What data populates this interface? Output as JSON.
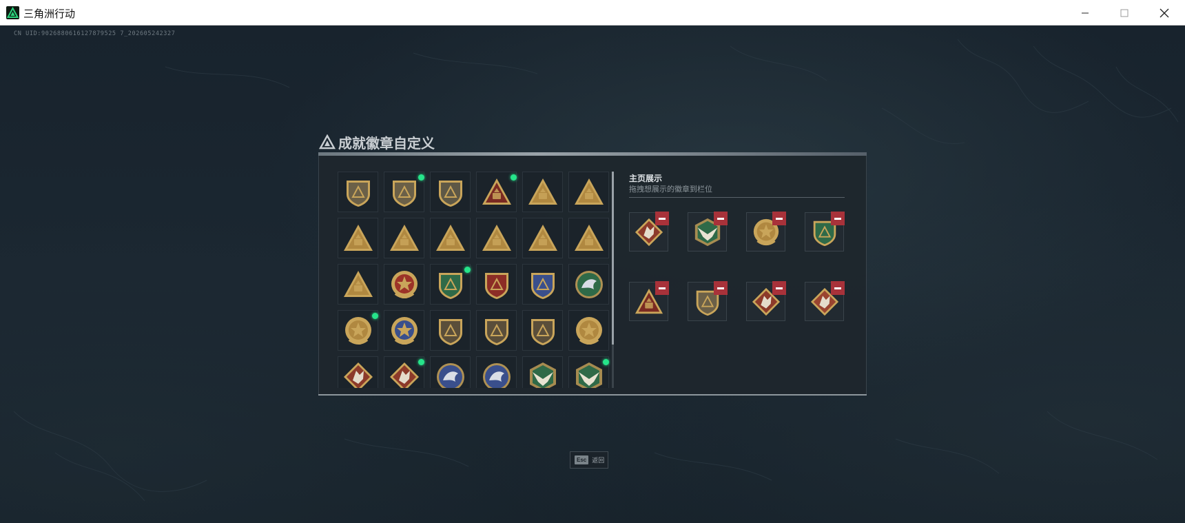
{
  "window": {
    "title": "三角洲行动",
    "app_icon": "delta-force-logo-icon",
    "controls": [
      "minimize-icon",
      "maximize-icon",
      "close-icon"
    ]
  },
  "uid_text": "CN UID:9026880616127879525 7_202605242327",
  "dialog": {
    "title": "成就徽章自定义",
    "title_icon": "delta-triangle-icon"
  },
  "badges": [
    {
      "name": "shield-triangle-badge",
      "shape": "shield",
      "color": "#6b6048",
      "new": false
    },
    {
      "name": "helicopter-badge",
      "shape": "shield",
      "color": "#6b6048",
      "new": true
    },
    {
      "name": "diamond-emblem-badge",
      "shape": "shield",
      "color": "#5e5846",
      "new": false
    },
    {
      "name": "red-triangle-badge",
      "shape": "triangle",
      "color": "#7a2a22",
      "new": true
    },
    {
      "name": "gold-triangle-vehicle-badge",
      "shape": "triangle",
      "color": "#b08840",
      "new": false
    },
    {
      "name": "gold-triangle-bag-badge",
      "shape": "triangle",
      "color": "#b08840",
      "new": false
    },
    {
      "name": "gold-triangle-sb-badge-1",
      "shape": "triangle",
      "color": "#b08840",
      "new": false
    },
    {
      "name": "gold-triangle-locker-badge",
      "shape": "triangle",
      "color": "#b08840",
      "new": false
    },
    {
      "name": "gold-triangle-sb-badge-2",
      "shape": "triangle",
      "color": "#b08840",
      "new": false
    },
    {
      "name": "gold-triangle-tower-badge",
      "shape": "triangle",
      "color": "#b08840",
      "new": false
    },
    {
      "name": "gold-triangle-helmet-badge",
      "shape": "triangle",
      "color": "#b08840",
      "new": false
    },
    {
      "name": "gold-triangle-number-one-badge",
      "shape": "triangle",
      "color": "#b08840",
      "new": false
    },
    {
      "name": "gold-triangle-crowd-badge",
      "shape": "triangle",
      "color": "#b08840",
      "new": false
    },
    {
      "name": "red-star-medal-badge",
      "shape": "medal",
      "color": "#9c3328",
      "new": false
    },
    {
      "name": "green-shield-badge",
      "shape": "shield",
      "color": "#2f6a48",
      "new": true
    },
    {
      "name": "red-gold-shield-badge",
      "shape": "shield",
      "color": "#8c2d26",
      "new": false
    },
    {
      "name": "blue-wolf-shield-badge",
      "shape": "shield",
      "color": "#3a4f8c",
      "new": false
    },
    {
      "name": "green-skull-badge",
      "shape": "circle",
      "color": "#2f6a48",
      "new": false
    },
    {
      "name": "gold-winged-shield-badge-1",
      "shape": "medal",
      "color": "#b08840",
      "new": true
    },
    {
      "name": "blue-eagle-shield-badge",
      "shape": "medal",
      "color": "#3a4f8c",
      "new": false
    },
    {
      "name": "rifle-shield-badge-1",
      "shape": "shield",
      "color": "#5a4e3a",
      "new": false
    },
    {
      "name": "rifle-shield-badge-2",
      "shape": "shield",
      "color": "#5a4e3a",
      "new": false
    },
    {
      "name": "hammer-shield-badge",
      "shape": "shield",
      "color": "#5a4e3a",
      "new": false
    },
    {
      "name": "gold-winged-shield-badge-2",
      "shape": "medal",
      "color": "#b08840",
      "new": false
    },
    {
      "name": "red-wolf-badge-1",
      "shape": "diamond",
      "color": "#8c3a2a",
      "new": false
    },
    {
      "name": "red-wolf-badge-2",
      "shape": "diamond",
      "color": "#8c3a2a",
      "new": true
    },
    {
      "name": "blue-dragon-badge-1",
      "shape": "circle",
      "color": "#3a4f8c",
      "new": false
    },
    {
      "name": "blue-dragon-badge-2",
      "shape": "circle",
      "color": "#3a4f8c",
      "new": false
    },
    {
      "name": "green-eagle-badge-1",
      "shape": "hexagon",
      "color": "#2f6a48",
      "new": false
    },
    {
      "name": "green-eagle-badge-2",
      "shape": "hexagon",
      "color": "#2f6a48",
      "new": true
    }
  ],
  "showcase": {
    "title": "主页展示",
    "subtitle": "拖拽想展示的徽章到栏位",
    "slots": [
      {
        "name": "red-horse-badge",
        "shape": "diamond",
        "color": "#8c3a2a"
      },
      {
        "name": "green-eagle-badge",
        "shape": "hexagon",
        "color": "#2f6a48"
      },
      {
        "name": "gold-winged-shield-badge",
        "shape": "medal",
        "color": "#b08840"
      },
      {
        "name": "green-shield-badge",
        "shape": "shield",
        "color": "#2f6a48"
      },
      {
        "name": "red-triangle-badge",
        "shape": "triangle",
        "color": "#7a2a22"
      },
      {
        "name": "helicopter-badge",
        "shape": "shield",
        "color": "#6b6048"
      },
      {
        "name": "red-wolf-badge",
        "shape": "diamond",
        "color": "#8c3a2a"
      },
      {
        "name": "red-wolf-badge-alt",
        "shape": "diamond",
        "color": "#9a4430"
      }
    ],
    "remove_icon": "minus-icon",
    "remove_color": "#a8323a"
  },
  "footer": {
    "esc_key": "Esc",
    "back_label": "返回"
  },
  "colors": {
    "new_dot": "#26e48a",
    "background": "#16202a",
    "panel": "#1e262d"
  }
}
